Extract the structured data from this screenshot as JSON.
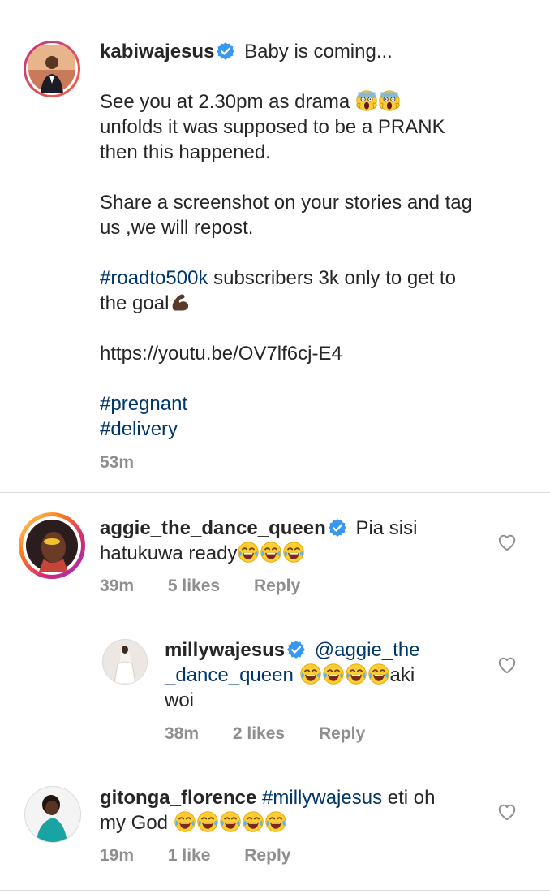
{
  "post": {
    "username": "kabiwajesus",
    "caption_first": "Baby is coming...",
    "line2a": "See you at 2.30pm as drama",
    "line2b": "unfolds it was supposed to be a PRANK",
    "line2c": "then this happened.",
    "line3a": "Share a screenshot on your stories and tag",
    "line3b": "us ,we will repost.",
    "hashtag_road": "#roadto500k",
    "line4a_rest": "subscribers 3k only to get to",
    "line4b": "the goal",
    "link": "https://youtu.be/OV7lf6cj-E4",
    "hashtag_pregnant": "#pregnant",
    "hashtag_delivery": "#delivery",
    "time": "53m"
  },
  "comments": [
    {
      "username": "aggie_the_dance_queen",
      "text_a": "Pia sisi",
      "text_b": "hatukuwa ready",
      "time": "39m",
      "likes": "5 likes",
      "reply": "Reply"
    },
    {
      "username": "millywajesus",
      "mention_a": "@aggie_the",
      "mention_b": "_dance_queen",
      "text_b_rest": "aki",
      "text_c": "woi",
      "time": "38m",
      "likes": "2 likes",
      "reply": "Reply"
    },
    {
      "username": "gitonga_florence",
      "mention": "#millywajesus",
      "text_a_rest": "eti oh",
      "text_b": "my God",
      "time": "19m",
      "likes": "1 like",
      "reply": "Reply"
    }
  ],
  "colors": {
    "text": "#262626",
    "link": "#00376b",
    "muted": "#8e8e8e",
    "verified": "#3897f0",
    "divider": "#dbdbdb"
  },
  "icons": [
    "verified-badge-icon",
    "heart-icon",
    "laughing-emoji-icon",
    "scream-emoji-icon",
    "flexed-biceps-emoji-icon"
  ]
}
